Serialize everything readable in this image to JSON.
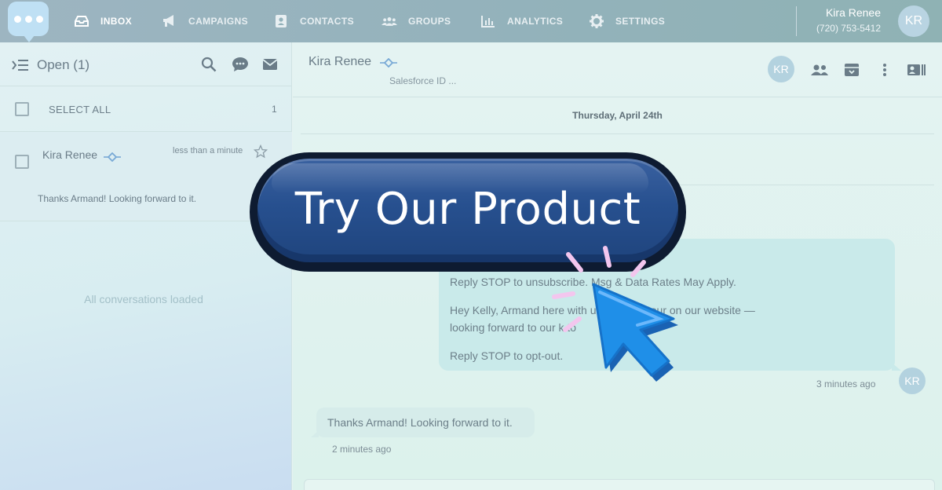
{
  "topbar": {
    "nav": [
      {
        "label": "INBOX",
        "icon": "inbox-icon"
      },
      {
        "label": "CAMPAIGNS",
        "icon": "megaphone-icon"
      },
      {
        "label": "CONTACTS",
        "icon": "contact-card-icon"
      },
      {
        "label": "GROUPS",
        "icon": "group-icon"
      },
      {
        "label": "ANALYTICS",
        "icon": "bar-chart-icon"
      },
      {
        "label": "SETTINGS",
        "icon": "gear-icon"
      }
    ],
    "user_name": "Kira Renee",
    "user_phone": "(720) 753-5412",
    "user_initials": "KR"
  },
  "left_panel": {
    "title": "Open (1)",
    "select_all_label": "SELECT ALL",
    "select_count": "1",
    "conversation": {
      "name": "Kira Renee",
      "time": "less than a minute",
      "preview": "Thanks Armand! Looking forward to it."
    },
    "loaded_text": "All conversations loaded"
  },
  "chat": {
    "contact_name": "Kira Renee",
    "salesforce_label": "Salesforce ID ...",
    "contact_initials": "KR",
    "date_separator": "Thursday, April 24th",
    "outgoing": {
      "line1": "Reply STOP to unsubscribe. Msg & Data Rates May Apply.",
      "line2": "Hey Kelly, Armand here with          u booked a tour on our website —",
      "line3": "looking forward to our   k to",
      "line4": "Reply STOP to opt-out.",
      "time": "3 minutes ago",
      "sender_initials": "KR"
    },
    "incoming": {
      "text": "Thanks Armand! Looking forward to it.",
      "time": "2 minutes ago"
    }
  },
  "cta": {
    "label": "Try Our Product"
  },
  "colors": {
    "cta_blue": "#27508f",
    "cta_outline": "#0e1b31",
    "cursor_blue": "#1f8fe8",
    "spark_pink": "#f3c6ee"
  }
}
